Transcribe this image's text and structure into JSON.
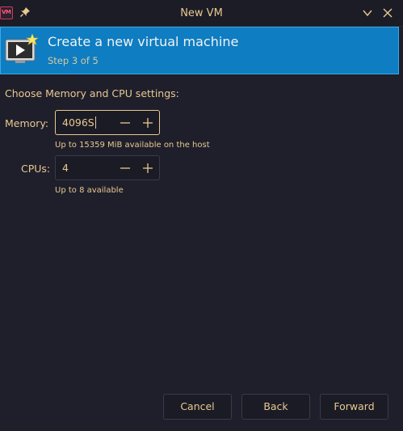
{
  "window": {
    "title": "New VM",
    "app_icon_text": "VM"
  },
  "header": {
    "title": "Create a new virtual machine",
    "step": "Step 3 of 5"
  },
  "form": {
    "section_label": "Choose Memory and CPU settings:",
    "memory": {
      "label": "Memory:",
      "value": "4096S",
      "hint": "Up to 15359 MiB available on the host"
    },
    "cpus": {
      "label": "CPUs:",
      "value": "4",
      "hint": "Up to 8 available"
    }
  },
  "buttons": {
    "cancel": "Cancel",
    "back": "Back",
    "forward": "Forward"
  },
  "colors": {
    "accent": "#0e7dc2",
    "text": "#e9c891",
    "background": "#1e1f2b"
  },
  "icons": [
    "virt-manager-app-icon",
    "pin-icon",
    "chevron-down-icon",
    "close-icon",
    "new-vm-icon",
    "minus-icon",
    "plus-icon"
  ]
}
